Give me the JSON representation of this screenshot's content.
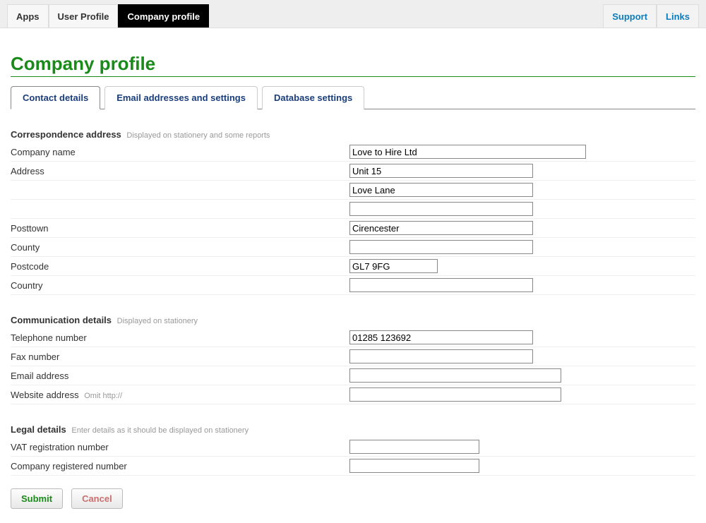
{
  "topnav": {
    "left": [
      {
        "label": "Apps"
      },
      {
        "label": "User Profile"
      },
      {
        "label": "Company profile"
      }
    ],
    "right": [
      {
        "label": "Support"
      },
      {
        "label": "Links"
      }
    ]
  },
  "page_title": "Company profile",
  "tabs": [
    {
      "label": "Contact details"
    },
    {
      "label": "Email addresses and settings"
    },
    {
      "label": "Database settings"
    }
  ],
  "sections": {
    "correspondence": {
      "title": "Correspondence address",
      "hint": "Displayed on stationery and some reports",
      "fields": {
        "company_name": {
          "label": "Company name",
          "value": "Love to Hire Ltd"
        },
        "address1": {
          "label": "Address",
          "value": "Unit 15"
        },
        "address2": {
          "label": "",
          "value": "Love Lane"
        },
        "address3": {
          "label": "",
          "value": ""
        },
        "posttown": {
          "label": "Posttown",
          "value": "Cirencester"
        },
        "county": {
          "label": "County",
          "value": ""
        },
        "postcode": {
          "label": "Postcode",
          "value": "GL7 9FG"
        },
        "country": {
          "label": "Country",
          "value": ""
        }
      }
    },
    "communication": {
      "title": "Communication details",
      "hint": "Displayed on stationery",
      "fields": {
        "telephone": {
          "label": "Telephone number",
          "value": "01285 123692"
        },
        "fax": {
          "label": "Fax number",
          "value": ""
        },
        "email": {
          "label": "Email address",
          "value": ""
        },
        "website": {
          "label": "Website address",
          "hint": "Omit http://",
          "value": ""
        }
      }
    },
    "legal": {
      "title": "Legal details",
      "hint": "Enter details as it should be displayed on stationery",
      "fields": {
        "vat": {
          "label": "VAT registration number",
          "value": ""
        },
        "company": {
          "label": "Company registered number",
          "value": ""
        }
      }
    }
  },
  "buttons": {
    "submit": "Submit",
    "cancel": "Cancel"
  }
}
